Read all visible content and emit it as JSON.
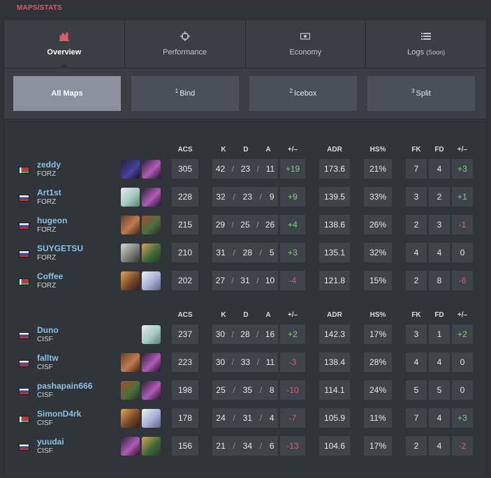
{
  "section_title": "MAPS/STATS",
  "tabs": [
    {
      "label": "Overview",
      "icon": "bar-chart-icon",
      "active": true
    },
    {
      "label": "Performance",
      "icon": "crosshair-icon",
      "active": false
    },
    {
      "label": "Economy",
      "icon": "money-icon",
      "active": false
    },
    {
      "label": "Logs",
      "soon": "(Soon)",
      "icon": "list-icon",
      "active": false
    }
  ],
  "maps": [
    {
      "num": "",
      "label": "All Maps",
      "active": true
    },
    {
      "num": "1",
      "label": "Bind",
      "active": false
    },
    {
      "num": "2",
      "label": "Icebox",
      "active": false
    },
    {
      "num": "3",
      "label": "Split",
      "active": false
    }
  ],
  "headers": {
    "acs": "ACS",
    "k": "K",
    "d": "D",
    "a": "A",
    "pm": "+/–",
    "adr": "ADR",
    "hs": "HS%",
    "fk": "FK",
    "fd": "FD",
    "fpm": "+/–"
  },
  "teams": [
    {
      "players": [
        {
          "name": "zeddy",
          "team": "FORZ",
          "flag": "by",
          "agents": [
            "omen",
            "reyna"
          ],
          "acs": "305",
          "k": "42",
          "d": "23",
          "a": "11",
          "pm": "+19",
          "adr": "173.6",
          "hs": "21%",
          "fk": "7",
          "fd": "4",
          "fpm": "+3"
        },
        {
          "name": "Art1st",
          "team": "FORZ",
          "flag": "ru",
          "agents": [
            "sage",
            "reyna"
          ],
          "acs": "228",
          "k": "32",
          "d": "23",
          "a": "9",
          "pm": "+9",
          "adr": "139.5",
          "hs": "33%",
          "fk": "3",
          "fd": "2",
          "fpm": "+1"
        },
        {
          "name": "hugeon",
          "team": "FORZ",
          "flag": "ru",
          "agents": [
            "brim",
            "raze"
          ],
          "acs": "215",
          "k": "29",
          "d": "25",
          "a": "26",
          "pm": "+4",
          "adr": "138.6",
          "hs": "26%",
          "fk": "2",
          "fd": "3",
          "fpm": "-1"
        },
        {
          "name": "SUYGETSU",
          "team": "FORZ",
          "flag": "ru",
          "agents": [
            "cypher",
            "skye"
          ],
          "acs": "210",
          "k": "31",
          "d": "28",
          "a": "5",
          "pm": "+3",
          "adr": "135.1",
          "hs": "32%",
          "fk": "4",
          "fd": "4",
          "fpm": "0"
        },
        {
          "name": "Coffee",
          "team": "FORZ",
          "flag": "by",
          "agents": [
            "phoenix",
            "jett"
          ],
          "acs": "202",
          "k": "27",
          "d": "31",
          "a": "10",
          "pm": "-4",
          "adr": "121.8",
          "hs": "15%",
          "fk": "2",
          "fd": "8",
          "fpm": "-6"
        }
      ]
    },
    {
      "players": [
        {
          "name": "Duno",
          "team": "CISF",
          "flag": "ru",
          "agents": [
            "",
            "sage"
          ],
          "acs": "237",
          "k": "30",
          "d": "28",
          "a": "16",
          "pm": "+2",
          "adr": "142.3",
          "hs": "17%",
          "fk": "3",
          "fd": "1",
          "fpm": "+2"
        },
        {
          "name": "falltw",
          "team": "CISF",
          "flag": "ru",
          "agents": [
            "brim",
            "reyna"
          ],
          "acs": "223",
          "k": "30",
          "d": "33",
          "a": "11",
          "pm": "-3",
          "adr": "138.4",
          "hs": "28%",
          "fk": "4",
          "fd": "4",
          "fpm": "0"
        },
        {
          "name": "pashapain666",
          "team": "CISF",
          "flag": "ru",
          "agents": [
            "raze",
            "reyna"
          ],
          "acs": "198",
          "k": "25",
          "d": "35",
          "a": "8",
          "pm": "-10",
          "adr": "114.1",
          "hs": "24%",
          "fk": "5",
          "fd": "5",
          "fpm": "0"
        },
        {
          "name": "SimonD4rk",
          "team": "CISF",
          "flag": "by",
          "agents": [
            "phoenix",
            "jett"
          ],
          "acs": "178",
          "k": "24",
          "d": "31",
          "a": "4",
          "pm": "-7",
          "adr": "105.9",
          "hs": "11%",
          "fk": "7",
          "fd": "4",
          "fpm": "+3"
        },
        {
          "name": "yuudai",
          "team": "CISF",
          "flag": "ru",
          "agents": [
            "reyna",
            "skye"
          ],
          "acs": "156",
          "k": "21",
          "d": "34",
          "a": "6",
          "pm": "-13",
          "adr": "104.6",
          "hs": "17%",
          "fk": "2",
          "fd": "4",
          "fpm": "-2"
        }
      ]
    }
  ],
  "colors": {
    "accent": "#e05a6a",
    "positive": "#7fd17f",
    "negative": "#e05a6a",
    "player_name": "#88c1e6"
  }
}
